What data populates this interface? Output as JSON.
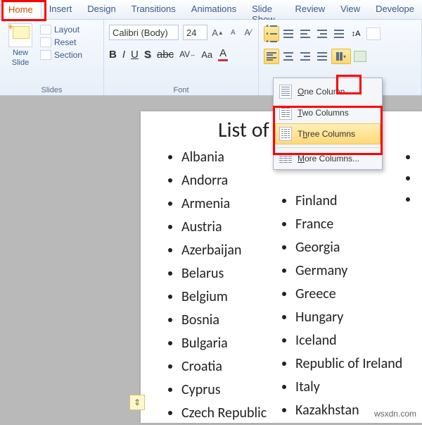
{
  "tabs": [
    "Home",
    "Insert",
    "Design",
    "Transitions",
    "Animations",
    "Slide Show",
    "Review",
    "View",
    "Develope"
  ],
  "slides_group": {
    "new_slide_line1": "New",
    "new_slide_line2": "Slide",
    "layout": "Layout",
    "reset": "Reset",
    "section": "Section",
    "label": "Slides"
  },
  "font_group": {
    "font_name": "Calibri (Body)",
    "font_size": "24",
    "label": "Font"
  },
  "columns_menu": {
    "one": "One Column",
    "two": "Two Columns",
    "three": "Three Columns",
    "more": "More Columns..."
  },
  "slide": {
    "title": "List of",
    "col1": [
      "Albania",
      "Andorra",
      "Armenia",
      "Austria",
      "Azerbaijan",
      "Belarus",
      "Belgium",
      "Bosnia",
      "Bulgaria",
      "Croatia",
      "Cyprus",
      "Czech Republic"
    ],
    "col2": [
      "Finland",
      "France",
      "Georgia",
      "Germany",
      "Greece",
      "Hungary",
      "Iceland",
      "Republic of Ireland",
      "Italy",
      "Kazakhstan"
    ]
  },
  "watermark": "wsxdn.com"
}
